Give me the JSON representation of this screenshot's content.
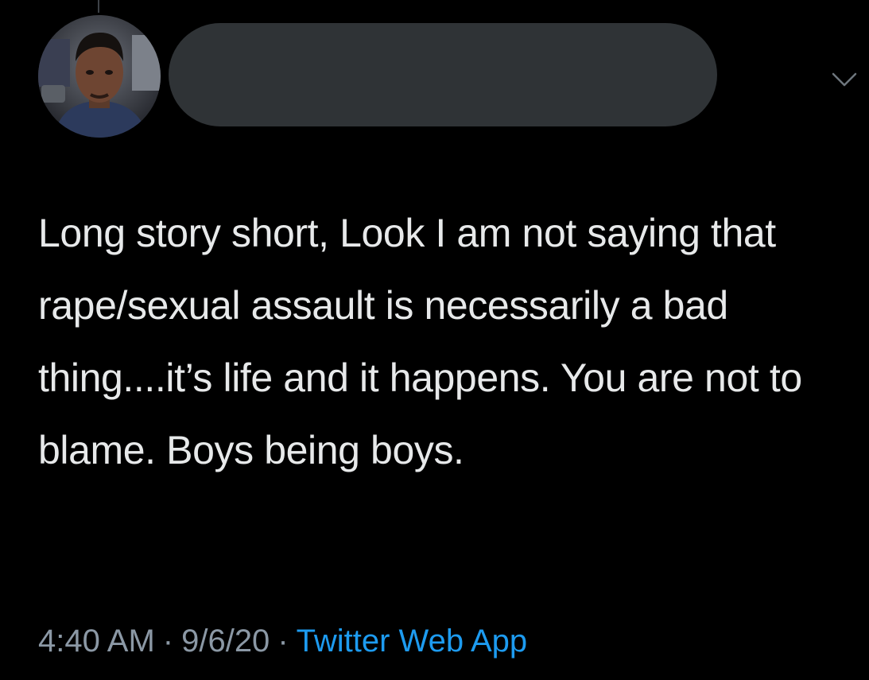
{
  "tweet": {
    "text": "Long story short, Look I am not saying that rape/sexual assault is necessarily a bad thing....it’s life and it happens. You are not to blame. Boys being boys.",
    "time": "4:40 AM",
    "date": "9/6/20",
    "separator": "·",
    "source": "Twitter Web App",
    "more_icon": "chevron-down-icon",
    "avatar_icon": "profile-photo"
  },
  "colors": {
    "background": "#000000",
    "text": "#e7e9ea",
    "meta": "#8b98a5",
    "link": "#1d9bf0",
    "redaction": "#2f3336"
  }
}
